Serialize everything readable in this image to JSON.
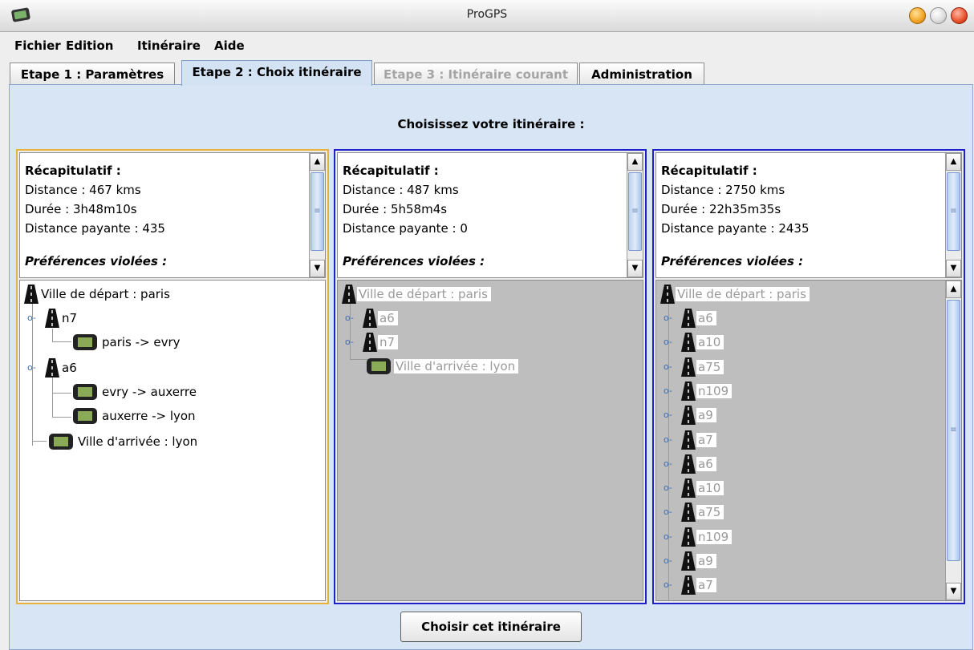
{
  "window": {
    "title": "ProGPS"
  },
  "menu": [
    "Fichier",
    "Edition",
    "Itinéraire",
    "Aide"
  ],
  "tabs": [
    {
      "label": "Etape 1 : Paramètres",
      "state": "normal"
    },
    {
      "label": "Etape 2 : Choix itinéraire",
      "state": "active"
    },
    {
      "label": "Etape 3 : Itinéraire courant",
      "state": "disabled"
    },
    {
      "label": "Administration",
      "state": "normal"
    }
  ],
  "heading": "Choisissez votre itinéraire :",
  "itineraries": [
    {
      "selected": true,
      "summary_title": "Récapitulatif :",
      "distance": "Distance : 467 kms",
      "duration": "Durée : 3h48m10s",
      "toll": "Distance payante : 435",
      "preferences": "Préférences violées :",
      "tree": {
        "start": "Ville de départ : paris",
        "roads": [
          {
            "name": "n7",
            "segments": [
              "paris -> evry"
            ]
          },
          {
            "name": "a6",
            "segments": [
              "evry -> auxerre",
              "auxerre -> lyon"
            ]
          }
        ],
        "end": "Ville d'arrivée : lyon"
      }
    },
    {
      "selected": false,
      "summary_title": "Récapitulatif :",
      "distance": "Distance : 487 kms",
      "duration": "Durée : 5h58m4s",
      "toll": "Distance payante : 0",
      "preferences": "Préférences violées :",
      "tree": {
        "start": "Ville de départ : paris",
        "roads": [
          "a6",
          "n7"
        ],
        "end": "Ville d'arrivée : lyon"
      }
    },
    {
      "selected": false,
      "summary_title": "Récapitulatif :",
      "distance": "Distance : 2750 kms",
      "duration": "Durée : 22h35m35s",
      "toll": "Distance payante : 2435",
      "preferences": "Préférences violées :",
      "tree": {
        "start": "Ville de départ : paris",
        "roads": [
          "a6",
          "a10",
          "a75",
          "n109",
          "a9",
          "a7",
          "a6",
          "a10",
          "a75",
          "n109",
          "a9",
          "a7"
        ]
      }
    }
  ],
  "button": {
    "label": "Choisir cet itinéraire"
  },
  "colors": {
    "selected_border": "#e8b23c",
    "column_border": "#2020c8",
    "panel_bg": "#d7e5f5"
  }
}
